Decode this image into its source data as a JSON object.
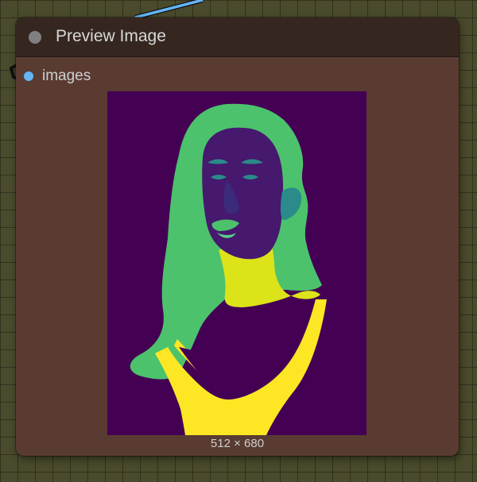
{
  "node": {
    "title": "Preview Image",
    "input_label": "images",
    "image_size": "512 × 680"
  },
  "colors": {
    "canvas_background": "#4a4a2c",
    "node_body": "#593b31",
    "node_header": "#352720",
    "slot_dot": "#64b5f6",
    "wire": "#64b5f6",
    "segmentation_background": "#440154",
    "segmentation_hair": "#4cc26c",
    "segmentation_face": "#46186e",
    "segmentation_neck": "#dce319",
    "segmentation_clothing": "#fde725",
    "segmentation_ear": "#2a8b8a"
  },
  "icons": {
    "collapse": "collapse-dot-icon",
    "input_slot": "input-slot-dot-icon"
  }
}
